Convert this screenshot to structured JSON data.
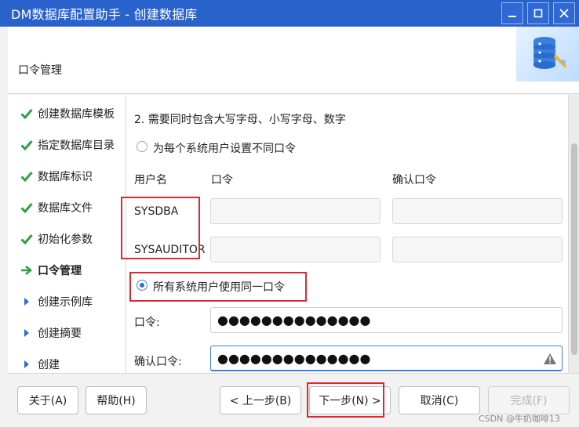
{
  "window": {
    "title": "DM数据库配置助手 - 创建数据库"
  },
  "header": {
    "section": "口令管理"
  },
  "steps": [
    {
      "label": "创建数据库模板",
      "state": "done"
    },
    {
      "label": "指定数据库目录",
      "state": "done"
    },
    {
      "label": "数据库标识",
      "state": "done"
    },
    {
      "label": "数据库文件",
      "state": "done"
    },
    {
      "label": "初始化参数",
      "state": "done"
    },
    {
      "label": "口令管理",
      "state": "current"
    },
    {
      "label": "创建示例库",
      "state": "pending"
    },
    {
      "label": "创建摘要",
      "state": "pending"
    },
    {
      "label": "创建",
      "state": "pending"
    }
  ],
  "content": {
    "rule_text": "2. 需要同时包含大写字母、小写字母、数字",
    "option_different": "为每个系统用户设置不同口令",
    "col_username": "用户名",
    "col_password": "口令",
    "col_confirm": "确认口令",
    "users": [
      "SYSDBA",
      "SYSAUDITOR"
    ],
    "option_same": "所有系统用户使用同一口令",
    "password_label": "口令:",
    "password_value": "●●●●●●●●●●●●●●",
    "confirm_label": "确认口令:",
    "confirm_value": "●●●●●●●●●●●●●●"
  },
  "buttons": {
    "about": "关于(A)",
    "help": "帮助(H)",
    "prev": "< 上一步(B)",
    "next": "下一步(N) >",
    "cancel": "取消(C)",
    "finish": "完成(F)"
  },
  "watermark": "CSDN @牛奶咖啡13",
  "colors": {
    "titlebar": "#2a62cc",
    "check": "#2ea043",
    "highlight": "#e0262f",
    "accent": "#2f6fd0"
  }
}
